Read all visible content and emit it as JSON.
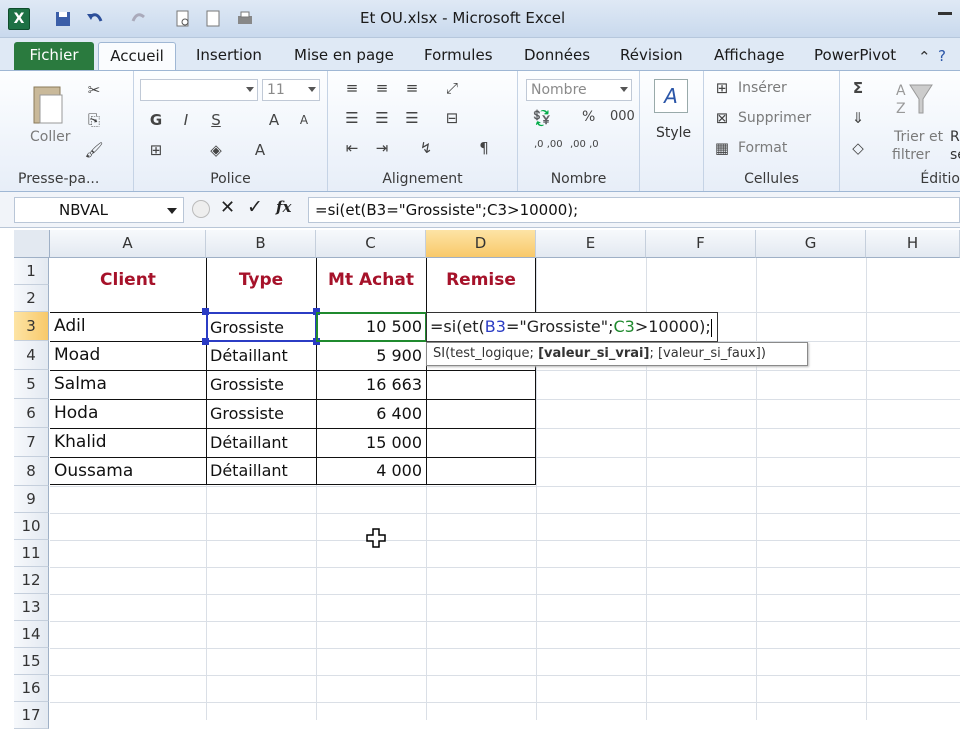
{
  "window": {
    "title": "Et OU.xlsx - Microsoft Excel",
    "logo": "X"
  },
  "tabs": [
    "Fichier",
    "Accueil",
    "Insertion",
    "Mise en page",
    "Formules",
    "Données",
    "Révision",
    "Affichage",
    "PowerPivot"
  ],
  "ribbon": {
    "clipboard": {
      "paste_label": "Coller",
      "group": "Presse-pa..."
    },
    "font": {
      "size": "11",
      "bold": "G",
      "italic": "I",
      "underline": "S",
      "group": "Police"
    },
    "alignment": {
      "group": "Alignement"
    },
    "number": {
      "format": "Nombre",
      "percent": "%",
      "thousands": "000",
      "dec_up": ",0 ,00",
      "dec_down": ",00 ,0",
      "group": "Nombre"
    },
    "style": {
      "label": "Style"
    },
    "cells": {
      "insert": "Insérer",
      "delete": "Supprimer",
      "format": "Format",
      "group": "Cellules"
    },
    "editing": {
      "sort_filter_1": "Trier et",
      "sort_filter_2": "filtrer",
      "find_1": "R",
      "find_2": "se",
      "group": "Éditio"
    }
  },
  "formula_bar": {
    "name_box": "NBVAL",
    "fx": "fx",
    "formula": "=si(et(B3=\"Grossiste\";C3>10000);"
  },
  "columns": [
    "A",
    "B",
    "C",
    "D",
    "E",
    "F",
    "G",
    "H"
  ],
  "rows": [
    "1",
    "2",
    "3",
    "4",
    "5",
    "6",
    "7",
    "8",
    "9",
    "10",
    "11",
    "12",
    "13",
    "14",
    "15",
    "16",
    "17"
  ],
  "table": {
    "headers": [
      "Client",
      "Type",
      "Mt Achat",
      "Remise"
    ],
    "rows": [
      [
        "Adil",
        "Grossiste",
        "10 500",
        ""
      ],
      [
        "Moad",
        "Détaillant",
        "5 900",
        ""
      ],
      [
        "Salma",
        "Grossiste",
        "16 663",
        ""
      ],
      [
        "Hoda",
        "Grossiste",
        "6 400",
        ""
      ],
      [
        "Khalid",
        "Détaillant",
        "15 000",
        ""
      ],
      [
        "Oussama",
        "Détaillant",
        "4 000",
        ""
      ]
    ]
  },
  "edit_cell": {
    "part1": "=si(et(",
    "ref1": "B3",
    "part2": "=\"Grossiste\";",
    "ref2": "C3",
    "part3": ">10000);"
  },
  "tooltip": {
    "fn": "SI(test_logique; ",
    "active": "[valeur_si_vrai]",
    "rest": "; [valeur_si_faux])"
  },
  "colors": {
    "header_text": "#a6122a",
    "ref1": "#2b3cc4",
    "ref2": "#1f8a2e",
    "fichier_tab": "#2a7a3e"
  }
}
